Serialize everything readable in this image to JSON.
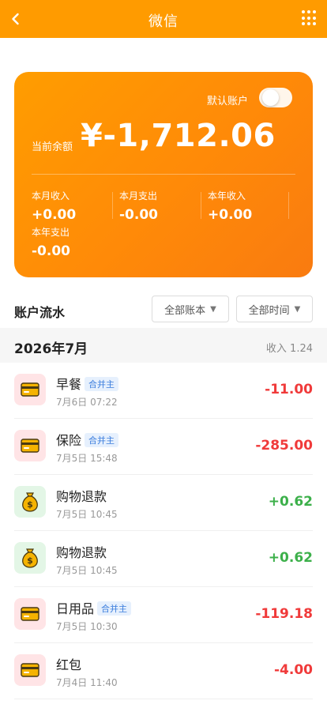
{
  "topbar": {
    "title": "微信"
  },
  "card": {
    "default_label": "默认账户",
    "balance_label": "当前余额",
    "balance_value": "¥-1,712.06",
    "stats": [
      {
        "label": "本月收入",
        "value": "+0.00"
      },
      {
        "label": "本月支出",
        "value": "-0.00"
      },
      {
        "label": "本年收入",
        "value": "+0.00"
      },
      {
        "label": "本年支出",
        "value": "-0.00"
      }
    ]
  },
  "ledger": {
    "title": "账户流水",
    "filter_book": "全部账本",
    "filter_time": "全部时间",
    "month": {
      "title": "2026年7月",
      "summary": "收入 1.24"
    },
    "rows": [
      {
        "name": "早餐",
        "tag": "合并主",
        "time": "7月6日 07:22",
        "amount": "-11.00",
        "icon": "card-icon"
      },
      {
        "name": "保险",
        "tag": "合并主",
        "time": "7月5日 15:48",
        "amount": "-285.00",
        "icon": "card-icon"
      },
      {
        "name": "购物退款",
        "tag": "",
        "time": "7月5日 10:45",
        "amount": "+0.62",
        "icon": "money-bag-icon"
      },
      {
        "name": "购物退款",
        "tag": "",
        "time": "7月5日 10:45",
        "amount": "+0.62",
        "icon": "money-bag-icon"
      },
      {
        "name": "日用品",
        "tag": "合并主",
        "time": "7月5日 10:30",
        "amount": "-119.18",
        "icon": "card-icon"
      },
      {
        "name": "红包",
        "tag": "",
        "time": "7月4日 11:40",
        "amount": "-4.00",
        "icon": "card-icon"
      }
    ]
  },
  "colors": {
    "accent": "#ff9b00",
    "expense": "#f03a3a",
    "income": "#3cb04a"
  }
}
